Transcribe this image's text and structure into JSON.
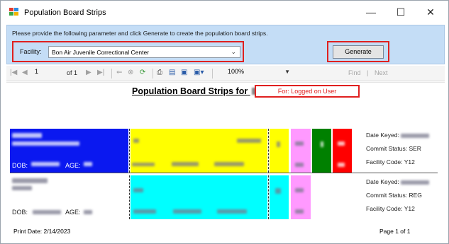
{
  "window": {
    "title": "Population Board Strips",
    "controls": {
      "minimize": "—",
      "maximize": "☐",
      "close": "✕"
    }
  },
  "parameters": {
    "instruction": "Please provide the following parameter and click Generate to create the population board strips.",
    "facility_label": "Facility:",
    "facility_value": "Bon Air Juvenile Correctional Center",
    "generate_label": "Generate"
  },
  "toolbar": {
    "page_number": "1",
    "page_of": "of 1",
    "zoom_value": "100%",
    "find_label": "Find",
    "find_separator": "|",
    "next_label": "Next"
  },
  "report": {
    "title": "Population Board Strips for",
    "logged_badge": "For: Logged on User",
    "strips": [
      {
        "dob_label": "DOB:",
        "age_label": "AGE:",
        "date_keyed_label": "Date Keyed:",
        "commit_status": "Commit Status: SER",
        "facility_code": "Facility Code: Y12"
      },
      {
        "dob_label": "DOB:",
        "age_label": "AGE:",
        "date_keyed_label": "Date Keyed:",
        "commit_status": "Commit Status: REG",
        "facility_code": "Facility Code: Y12"
      }
    ],
    "print_date": "Print Date: 2/14/2023",
    "page_info": "Page 1 of 1"
  },
  "colors": {
    "highlight_border": "#e0201f",
    "param_panel": "#c4ddf6",
    "strip1_name": "#0a18f0",
    "yellow": "#ffff00",
    "cyan": "#00ffff",
    "pink": "#ff99ff",
    "green": "#008000",
    "red": "#ff0000"
  }
}
